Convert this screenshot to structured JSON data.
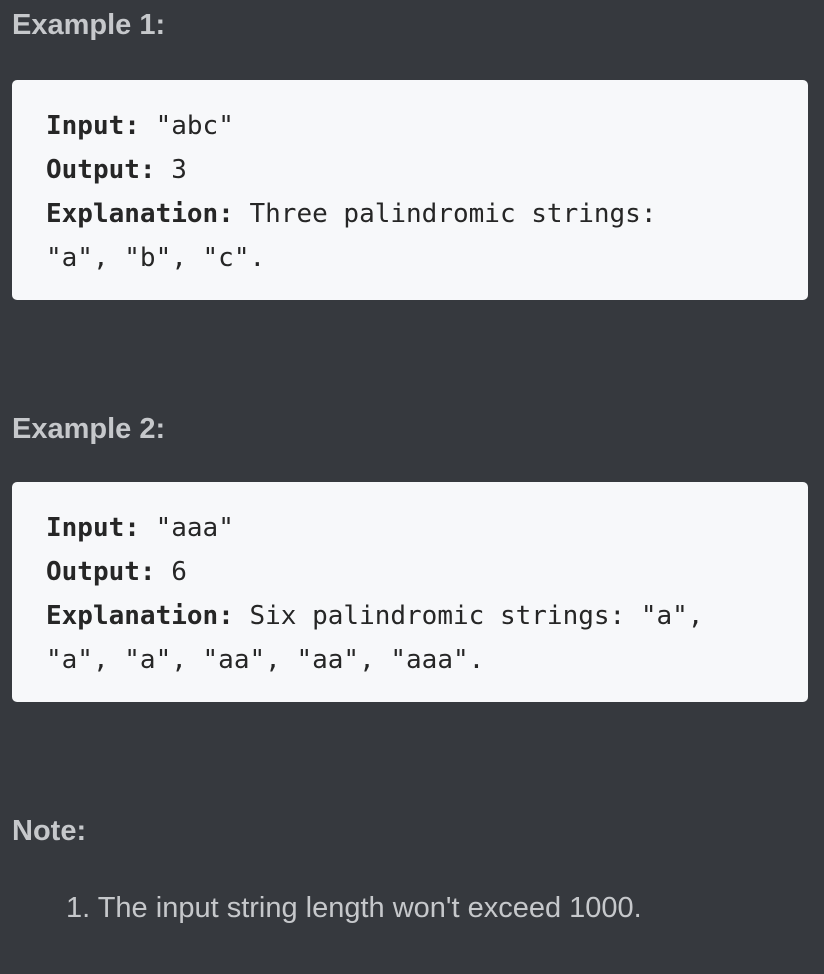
{
  "examples": [
    {
      "heading": "Example 1:",
      "input_label": "Input:",
      "input_value": " \"abc\"",
      "output_label": "Output:",
      "output_value": " 3",
      "explanation_label": "Explanation:",
      "explanation_line1": " Three palindromic strings:",
      "explanation_line2": "\"a\", \"b\", \"c\"."
    },
    {
      "heading": "Example 2:",
      "input_label": "Input:",
      "input_value": " \"aaa\"",
      "output_label": "Output:",
      "output_value": " 6",
      "explanation_label": "Explanation:",
      "explanation_line1": " Six palindromic strings: \"a\",",
      "explanation_line2": "\"a\", \"a\", \"aa\", \"aa\", \"aaa\"."
    }
  ],
  "note": {
    "heading": "Note:",
    "items": [
      {
        "marker": "1. ",
        "text": "The input string length won't exceed 1000."
      }
    ]
  }
}
